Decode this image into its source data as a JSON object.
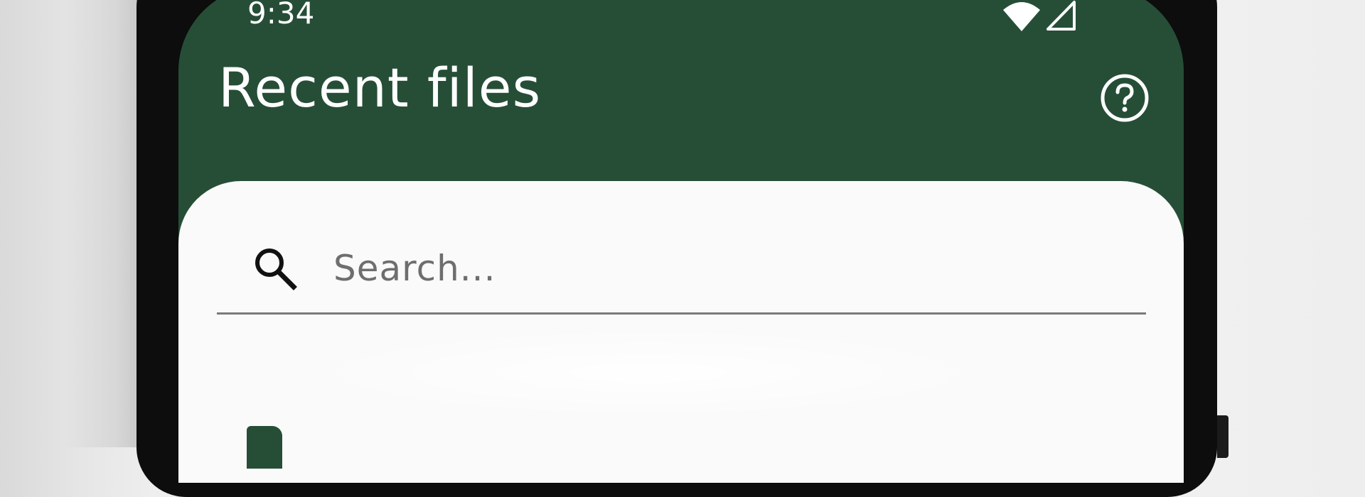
{
  "status_bar": {
    "time": "9:34",
    "icons": [
      "wifi-icon",
      "cellular-signal-icon"
    ]
  },
  "header": {
    "title": "Recent files",
    "help_icon": "help-circle-icon"
  },
  "search": {
    "placeholder": "Search...",
    "value": "",
    "icon": "search-icon"
  },
  "colors": {
    "header_background": "#264e37",
    "sheet_background": "#fafafa",
    "header_text": "#ffffff",
    "placeholder_text": "#6e6e6e",
    "underline": "#7a7a7a"
  },
  "list": {
    "first_item_icon": "file-icon"
  }
}
